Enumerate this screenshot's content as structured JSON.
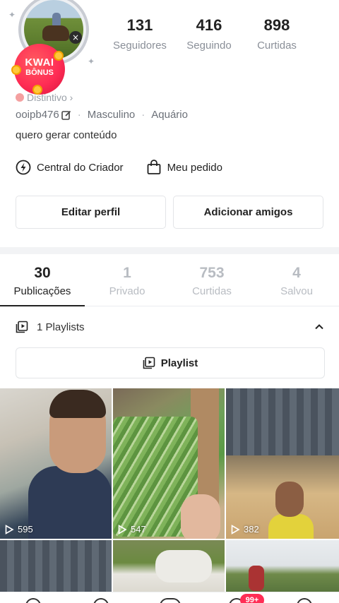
{
  "profile": {
    "kwai_badge": {
      "line1": "KWAI",
      "line2": "BÔNUS"
    },
    "avatar_close": "×",
    "stats": [
      {
        "value": "131",
        "label": "Seguidores"
      },
      {
        "value": "416",
        "label": "Seguindo"
      },
      {
        "value": "898",
        "label": "Curtidas"
      }
    ],
    "distintivo": "Distintivo ›",
    "username": "ooipb476",
    "gender": "Masculino",
    "sign": "Aquário",
    "separator": "·",
    "bio": "quero gerar conteúdo"
  },
  "quick_links": {
    "creator_center": "Central do Criador",
    "my_order": "Meu pedido"
  },
  "buttons": {
    "edit_profile": "Editar perfil",
    "add_friends": "Adicionar amigos"
  },
  "tabs": [
    {
      "count": "30",
      "label": "Publicações",
      "active": true
    },
    {
      "count": "1",
      "label": "Privado",
      "active": false
    },
    {
      "count": "753",
      "label": "Curtidas",
      "active": false
    },
    {
      "count": "4",
      "label": "Salvou",
      "active": false
    }
  ],
  "playlists": {
    "header": "1 Playlists",
    "button": "Playlist"
  },
  "grid": [
    {
      "views": "595"
    },
    {
      "views": "547"
    },
    {
      "views": "382"
    },
    {
      "views": ""
    },
    {
      "views": ""
    },
    {
      "views": ""
    }
  ],
  "bottom_nav": {
    "badge": "99+"
  },
  "colors": {
    "accent_badge": "#ff2d55",
    "text_primary": "#222222",
    "text_secondary": "#8a8f98"
  }
}
